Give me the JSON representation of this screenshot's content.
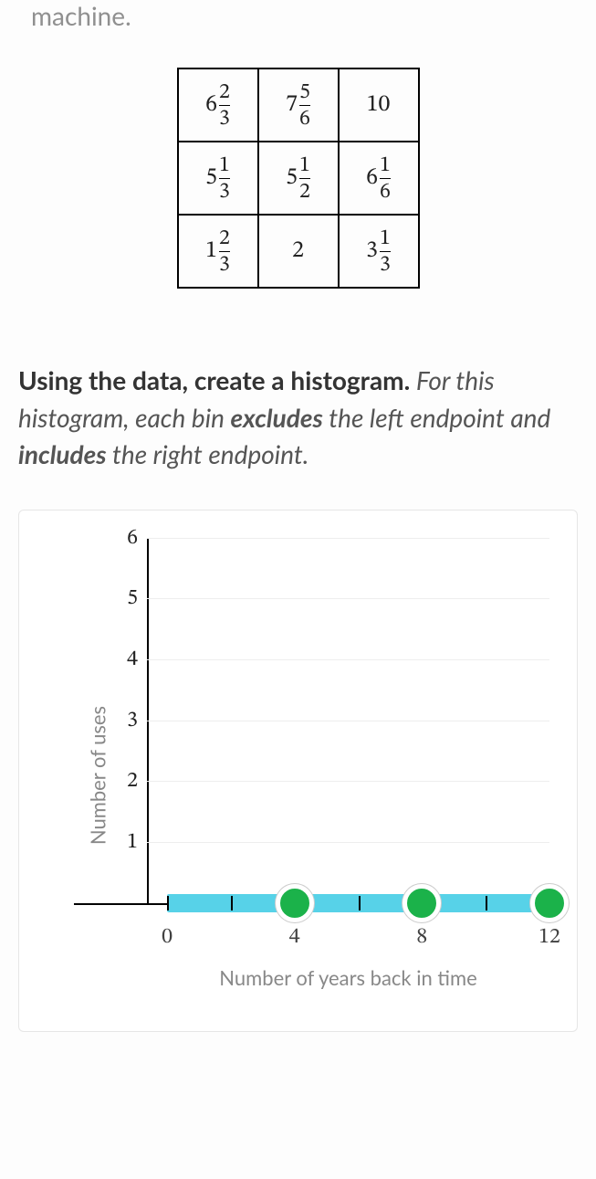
{
  "intro_text": "machine.",
  "table": {
    "rows": [
      [
        {
          "whole": "6",
          "num": "2",
          "den": "3"
        },
        {
          "whole": "7",
          "num": "5",
          "den": "6"
        },
        {
          "whole": "10"
        }
      ],
      [
        {
          "whole": "5",
          "num": "1",
          "den": "3"
        },
        {
          "whole": "5",
          "num": "1",
          "den": "2"
        },
        {
          "whole": "6",
          "num": "1",
          "den": "6"
        }
      ],
      [
        {
          "whole": "1",
          "num": "2",
          "den": "3"
        },
        {
          "whole": "2"
        },
        {
          "whole": "3",
          "num": "1",
          "den": "3"
        }
      ]
    ]
  },
  "instruction": {
    "bold_lead": "Using the data, create a histogram.",
    "rest1": " For this histogram, each bin ",
    "bold2": "excludes",
    "rest2": " the left endpoint and ",
    "bold3": "includes",
    "rest3": " the right endpoint."
  },
  "chart_data": {
    "type": "bar",
    "ylabel": "Number of uses",
    "xlabel": "Number of years back in time",
    "ylim": [
      0,
      6
    ],
    "y_ticks": [
      1,
      2,
      3,
      4,
      5,
      6
    ],
    "x_ticks": [
      0,
      4,
      8,
      12
    ],
    "x_range": [
      0,
      12
    ],
    "bars": [
      {
        "bin_left": 0,
        "bin_right": 4,
        "value": 0
      },
      {
        "bin_left": 4,
        "bin_right": 8,
        "value": 0
      },
      {
        "bin_left": 8,
        "bin_right": 12,
        "value": 0
      }
    ],
    "handles": [
      4,
      8,
      12
    ]
  }
}
